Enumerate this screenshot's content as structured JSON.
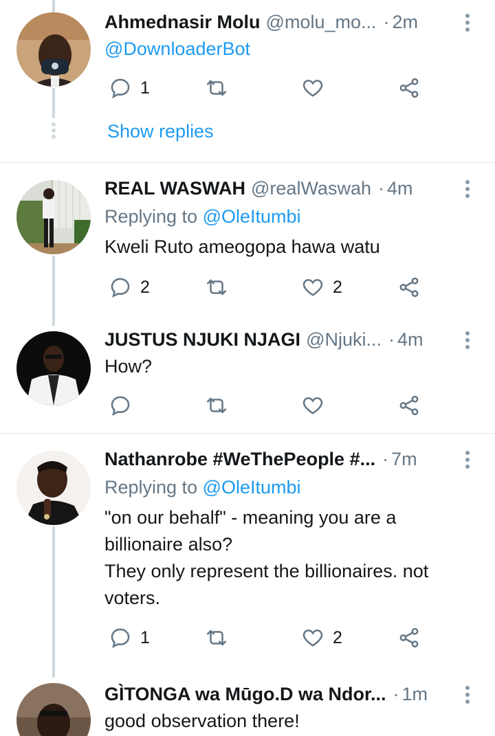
{
  "tweets": [
    {
      "name": "Ahmednasir Molu",
      "handle": "@molu_mo...",
      "time": "2m",
      "mention_line": "@DownloaderBot",
      "reply_count": "1",
      "like_count": "",
      "show_replies": "Show replies"
    },
    {
      "name": "REAL WASWAH",
      "handle": "@realWaswah",
      "time": "4m",
      "replying_prefix": "Replying to",
      "replying_mention": "@OleItumbi",
      "text": "Kweli Ruto ameogopa hawa watu",
      "reply_count": "2",
      "like_count": "2"
    },
    {
      "name": "JUSTUS NJUKI NJAGI",
      "handle": "@Njuki...",
      "time": "4m",
      "text": "How?",
      "reply_count": "",
      "like_count": ""
    },
    {
      "name": "Nathanrobe #WeThePeople #...",
      "handle": "",
      "time": "7m",
      "replying_prefix": "Replying to",
      "replying_mention": "@OleItumbi",
      "text_lines": [
        "\"on our behalf\" - meaning you are a",
        "billionaire also?",
        "They only represent the billionaires. not",
        "voters."
      ],
      "reply_count": "1",
      "like_count": "2"
    },
    {
      "name": "GÌTONGA wa Mūgo.D wa Ndor...",
      "handle": "",
      "time": "1m",
      "text": "good observation there!"
    }
  ],
  "separator": "·",
  "icons": [
    "reply-icon",
    "retweet-icon",
    "like-icon",
    "share-icon",
    "more-icon"
  ],
  "colors": {
    "link": "#1d9bf0",
    "muted": "#657786",
    "text": "#14171a",
    "divider": "#e1e8ed",
    "thread": "#cfd9de"
  }
}
